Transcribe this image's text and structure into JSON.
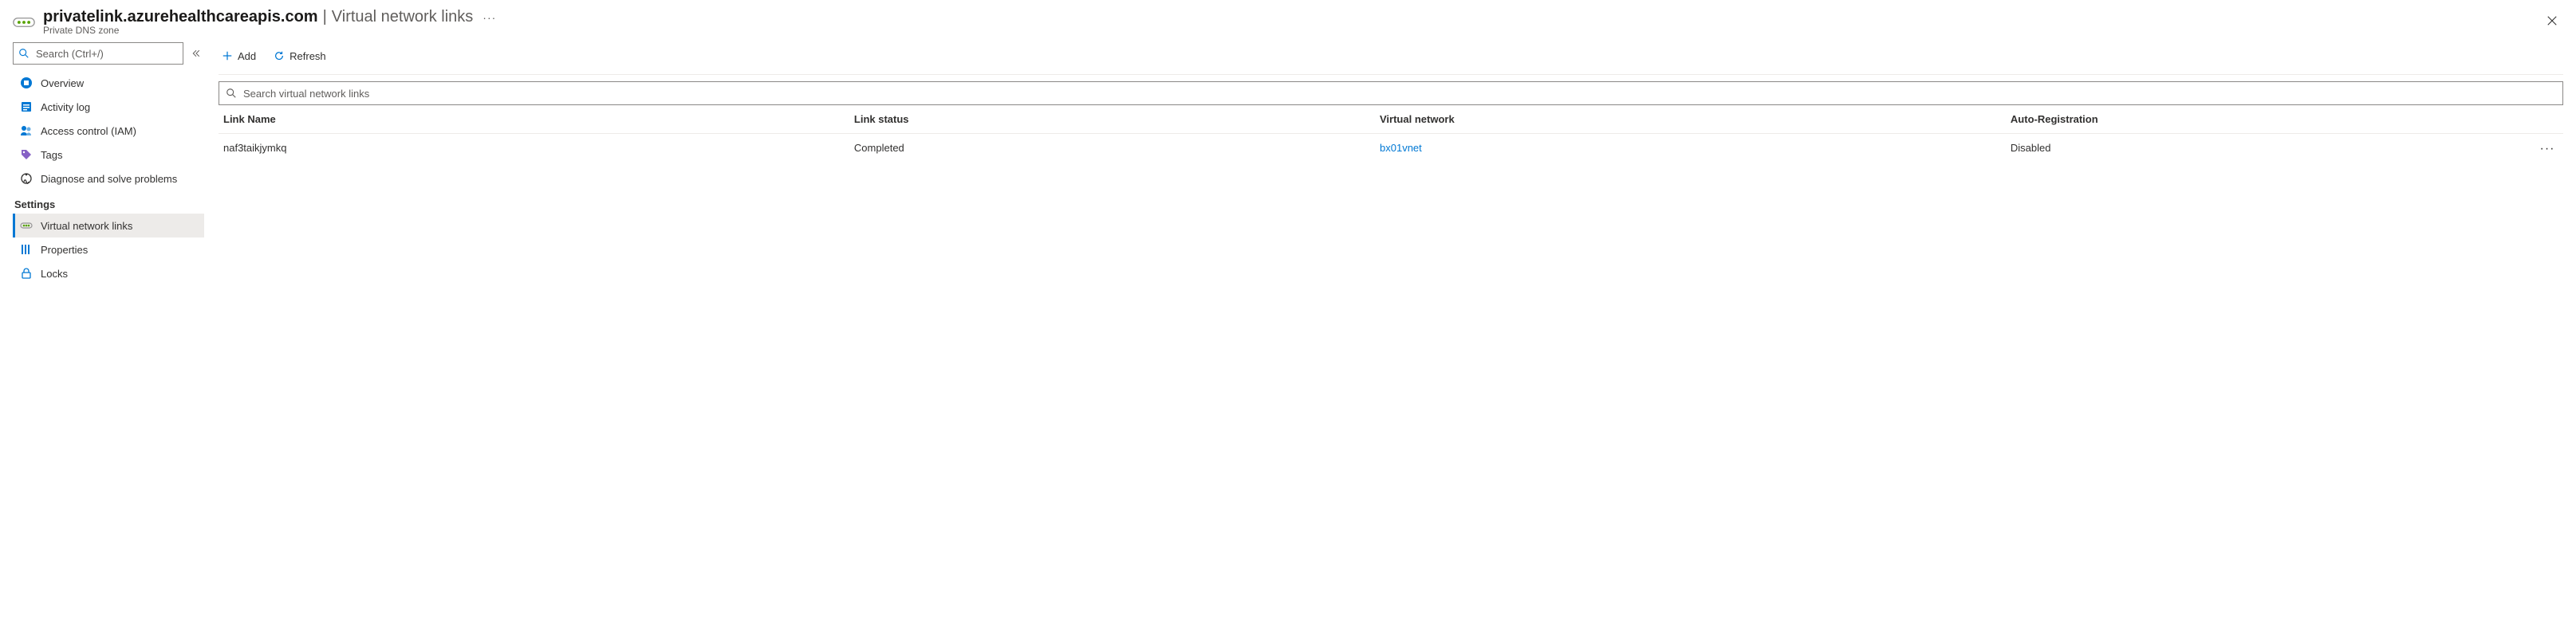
{
  "header": {
    "title_main": "privatelink.azurehealthcareapis.com",
    "title_sep": "|",
    "title_sub": "Virtual network links",
    "subtitle": "Private DNS zone",
    "more": "···"
  },
  "sidebar": {
    "search_placeholder": "Search (Ctrl+/)",
    "items_top": [
      {
        "id": "overview",
        "label": "Overview",
        "icon": "overview-icon"
      },
      {
        "id": "activity-log",
        "label": "Activity log",
        "icon": "activity-log-icon"
      },
      {
        "id": "access-control",
        "label": "Access control (IAM)",
        "icon": "access-control-icon"
      },
      {
        "id": "tags",
        "label": "Tags",
        "icon": "tags-icon"
      },
      {
        "id": "diagnose",
        "label": "Diagnose and solve problems",
        "icon": "diagnose-icon"
      }
    ],
    "group_label": "Settings",
    "items_settings": [
      {
        "id": "vnet-links",
        "label": "Virtual network links",
        "icon": "vnet-links-icon",
        "selected": true
      },
      {
        "id": "properties",
        "label": "Properties",
        "icon": "properties-icon"
      },
      {
        "id": "locks",
        "label": "Locks",
        "icon": "locks-icon"
      }
    ]
  },
  "toolbar": {
    "add_label": "Add",
    "refresh_label": "Refresh"
  },
  "list": {
    "search_placeholder": "Search virtual network links",
    "columns": {
      "link_name": "Link Name",
      "link_status": "Link status",
      "virtual_network": "Virtual network",
      "auto_registration": "Auto-Registration"
    },
    "rows": [
      {
        "link_name": "naf3taikjymkq",
        "link_status": "Completed",
        "virtual_network": "bx01vnet",
        "auto_registration": "Disabled"
      }
    ]
  }
}
